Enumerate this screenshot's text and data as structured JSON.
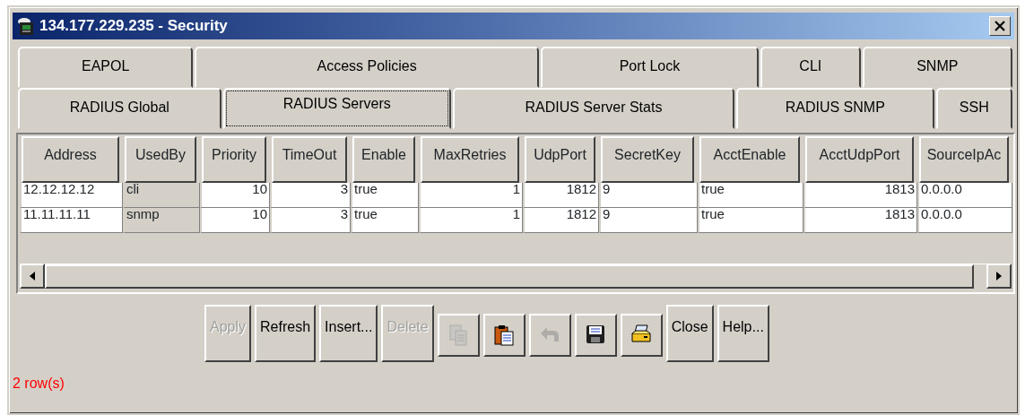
{
  "window": {
    "title": "134.177.229.235 - Security"
  },
  "tab_rows": [
    [
      {
        "label": "EAPOL",
        "selected": false
      },
      {
        "label": "Access Policies",
        "selected": false
      },
      {
        "label": "Port Lock",
        "selected": false
      },
      {
        "label": "CLI",
        "selected": false
      },
      {
        "label": "SNMP",
        "selected": false
      }
    ],
    [
      {
        "label": "RADIUS Global",
        "selected": false
      },
      {
        "label": "RADIUS Servers",
        "selected": true
      },
      {
        "label": "RADIUS Server Stats",
        "selected": false
      },
      {
        "label": "RADIUS SNMP",
        "selected": false
      },
      {
        "label": "SSH",
        "selected": false
      }
    ]
  ],
  "table": {
    "columns": [
      {
        "label": "Address",
        "kind": "text",
        "editable": true
      },
      {
        "label": "UsedBy",
        "kind": "text",
        "editable": false
      },
      {
        "label": "Priority",
        "kind": "number",
        "editable": true
      },
      {
        "label": "TimeOut",
        "kind": "number",
        "editable": true
      },
      {
        "label": "Enable",
        "kind": "text",
        "editable": true
      },
      {
        "label": "MaxRetries",
        "kind": "number",
        "editable": true
      },
      {
        "label": "UdpPort",
        "kind": "number",
        "editable": true
      },
      {
        "label": "SecretKey",
        "kind": "text",
        "editable": true
      },
      {
        "label": "AcctEnable",
        "kind": "text",
        "editable": true
      },
      {
        "label": "AcctUdpPort",
        "kind": "number",
        "editable": true
      },
      {
        "label": "SourceIpAc",
        "kind": "text",
        "editable": true
      }
    ],
    "rows": [
      [
        "12.12.12.12",
        "cli",
        "10",
        "3",
        "true",
        "1",
        "1812",
        "9",
        "true",
        "1813",
        "0.0.0.0"
      ],
      [
        "11.11.11.11",
        "snmp",
        "10",
        "3",
        "true",
        "1",
        "1812",
        "9",
        "true",
        "1813",
        "0.0.0.0"
      ]
    ]
  },
  "toolbar": [
    {
      "kind": "text",
      "label": "Apply",
      "disabled": true
    },
    {
      "kind": "text",
      "label": "Refresh",
      "disabled": false
    },
    {
      "kind": "text",
      "label": "Insert...",
      "disabled": false
    },
    {
      "kind": "text",
      "label": "Delete",
      "disabled": true
    },
    {
      "kind": "icon",
      "disabled": true
    },
    {
      "kind": "icon",
      "disabled": false
    },
    {
      "kind": "icon",
      "disabled": true
    },
    {
      "kind": "icon",
      "disabled": false
    },
    {
      "kind": "icon",
      "disabled": false
    },
    {
      "kind": "text",
      "label": "Close",
      "disabled": false
    },
    {
      "kind": "text",
      "label": "Help...",
      "disabled": false
    }
  ],
  "status_bar": {
    "text": "2 row(s)"
  }
}
